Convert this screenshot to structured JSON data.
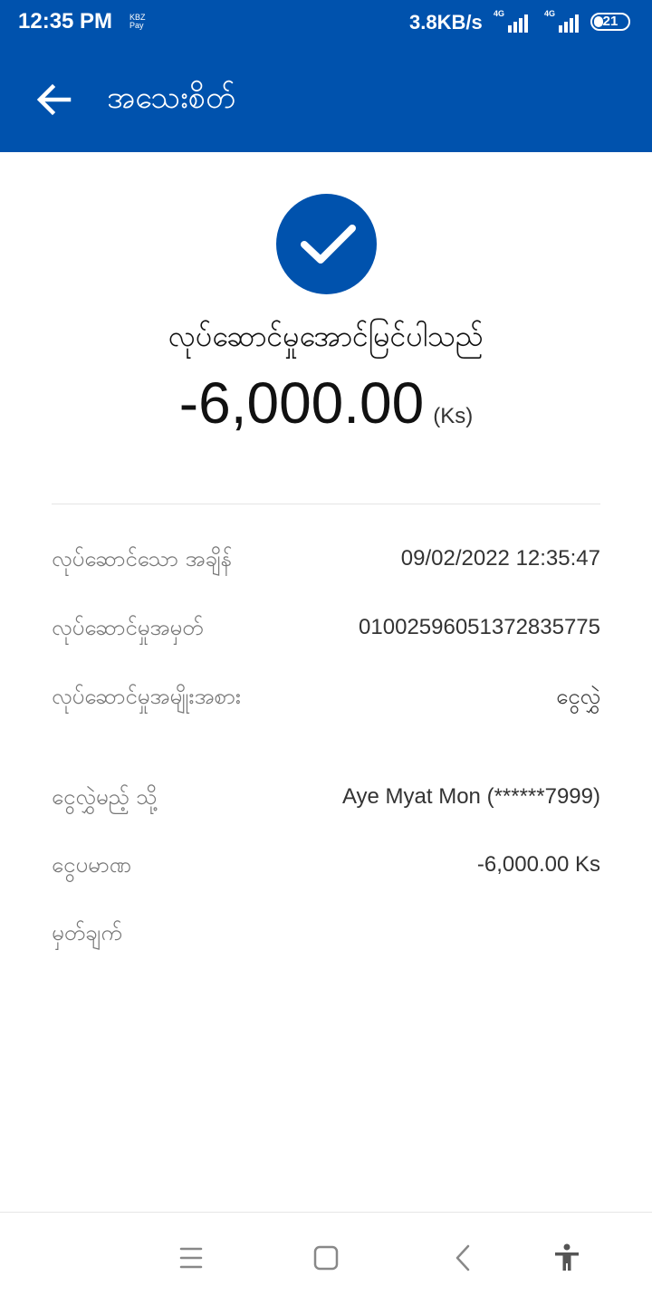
{
  "status_bar": {
    "time": "12:35 PM",
    "app_badge_line1": "KBZ",
    "app_badge_line2": "Pay",
    "network_speed": "3.8KB/s",
    "sim1_tag": "4G",
    "sim2_tag": "4G",
    "battery_level": "21"
  },
  "header": {
    "title": "အသေးစိတ်",
    "back_icon": "arrow-left-icon",
    "background_color": "#0052ad"
  },
  "summary": {
    "status_icon": "check-circle-icon",
    "status_text": "လုပ်ဆောင်မှုအောင်မြင်ပါသည်",
    "amount": "-6,000.00",
    "currency": "(Ks)"
  },
  "details": [
    {
      "label": "လုပ်ဆောင်သော အချိန်",
      "value": "09/02/2022 12:35:47"
    },
    {
      "label": "လုပ်ဆောင်မှုအမှတ်",
      "value": "01002596051372835775"
    },
    {
      "label": "လုပ်ဆောင်မှုအမျိုးအစား",
      "value": "ငွေလွှဲ"
    },
    {
      "label": "ငွေလွှဲမည့် သို့",
      "value": "Aye Myat Mon (******7999)"
    },
    {
      "label": "ငွေပမာဏ",
      "value": "-6,000.00 Ks"
    },
    {
      "label": "မှတ်ချက်",
      "value": ""
    }
  ],
  "nav_bar": {
    "icons": [
      "menu-icon",
      "home-square-icon",
      "back-chevron-icon",
      "accessibility-icon"
    ]
  }
}
